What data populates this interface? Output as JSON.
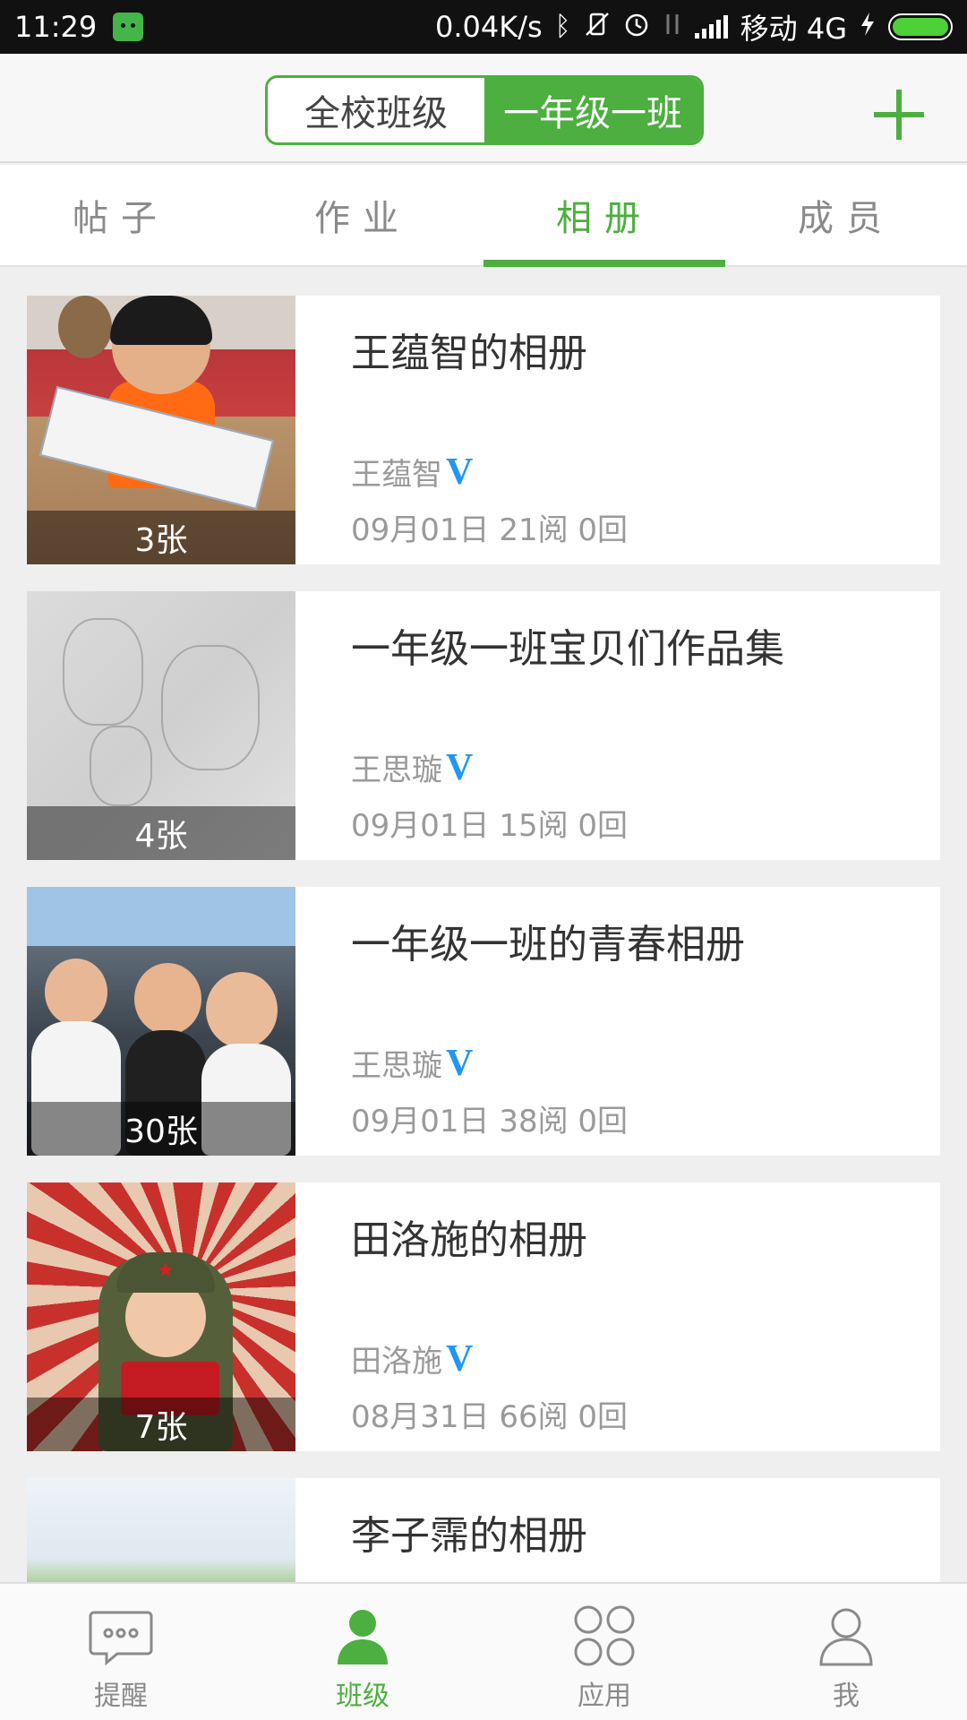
{
  "status_bar": {
    "time": "11:29",
    "network_speed": "0.04K/s",
    "carrier": "移动 4G",
    "icons": [
      "android-icon",
      "bluetooth-icon",
      "vibrate-off-icon",
      "alarm-icon",
      "data-transfer-icon",
      "signal-icon",
      "charging-icon",
      "battery-icon"
    ]
  },
  "header": {
    "segments": [
      {
        "label": "全校班级",
        "active": false
      },
      {
        "label": "一年级一班",
        "active": true
      }
    ],
    "add_icon": "plus-icon",
    "accent_color": "#4caf3f"
  },
  "tabs": [
    {
      "label": "帖子",
      "active": false
    },
    {
      "label": "作业",
      "active": false
    },
    {
      "label": "相册",
      "active": true
    },
    {
      "label": "成员",
      "active": false
    }
  ],
  "albums": [
    {
      "title": "王蕴智的相册",
      "author": "王蕴智",
      "verified": "V",
      "photo_count": "3张",
      "meta": "09月01日 21阅 0回"
    },
    {
      "title": "一年级一班宝贝们作品集",
      "author": "王思璇",
      "verified": "V",
      "photo_count": "4张",
      "meta": "09月01日 15阅 0回"
    },
    {
      "title": "一年级一班的青春相册",
      "author": "王思璇",
      "verified": "V",
      "photo_count": "30张",
      "meta": "09月01日 38阅 0回"
    },
    {
      "title": "田洛施的相册",
      "author": "田洛施",
      "verified": "V",
      "photo_count": "7张",
      "meta": "08月31日 66阅 0回"
    },
    {
      "title": "李子霈的相册"
    }
  ],
  "bottom_nav": [
    {
      "label": "提醒",
      "icon": "chat-bubble-icon",
      "active": false
    },
    {
      "label": "班级",
      "icon": "person-icon",
      "active": true
    },
    {
      "label": "应用",
      "icon": "apps-grid-icon",
      "active": false
    },
    {
      "label": "我",
      "icon": "profile-icon",
      "active": false
    }
  ]
}
